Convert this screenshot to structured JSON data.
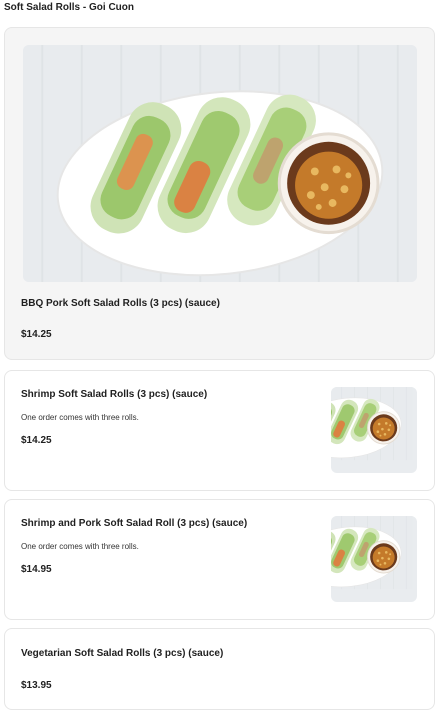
{
  "section": {
    "title": "Soft Salad Rolls - Goi Cuon"
  },
  "items": [
    {
      "name": "BBQ Pork Soft Salad Rolls (3 pcs) (sauce)",
      "description": "",
      "price": "$14.25",
      "image_icon": "salad-rolls-photo"
    },
    {
      "name": "Shrimp Soft Salad Rolls (3 pcs) (sauce)",
      "description": "One order comes with three rolls.",
      "price": "$14.25",
      "image_icon": "salad-rolls-photo"
    },
    {
      "name": "Shrimp and Pork Soft Salad Roll (3 pcs) (sauce)",
      "description": "One order comes with three rolls.",
      "price": "$14.95",
      "image_icon": "salad-rolls-photo"
    },
    {
      "name": "Vegetarian Soft Salad Rolls (3 pcs) (sauce)",
      "description": "",
      "price": "$13.95"
    }
  ],
  "colors": {
    "card_border": "#e6e6e6",
    "featured_bg": "#f5f5f5",
    "text": "#1f1f1f"
  }
}
